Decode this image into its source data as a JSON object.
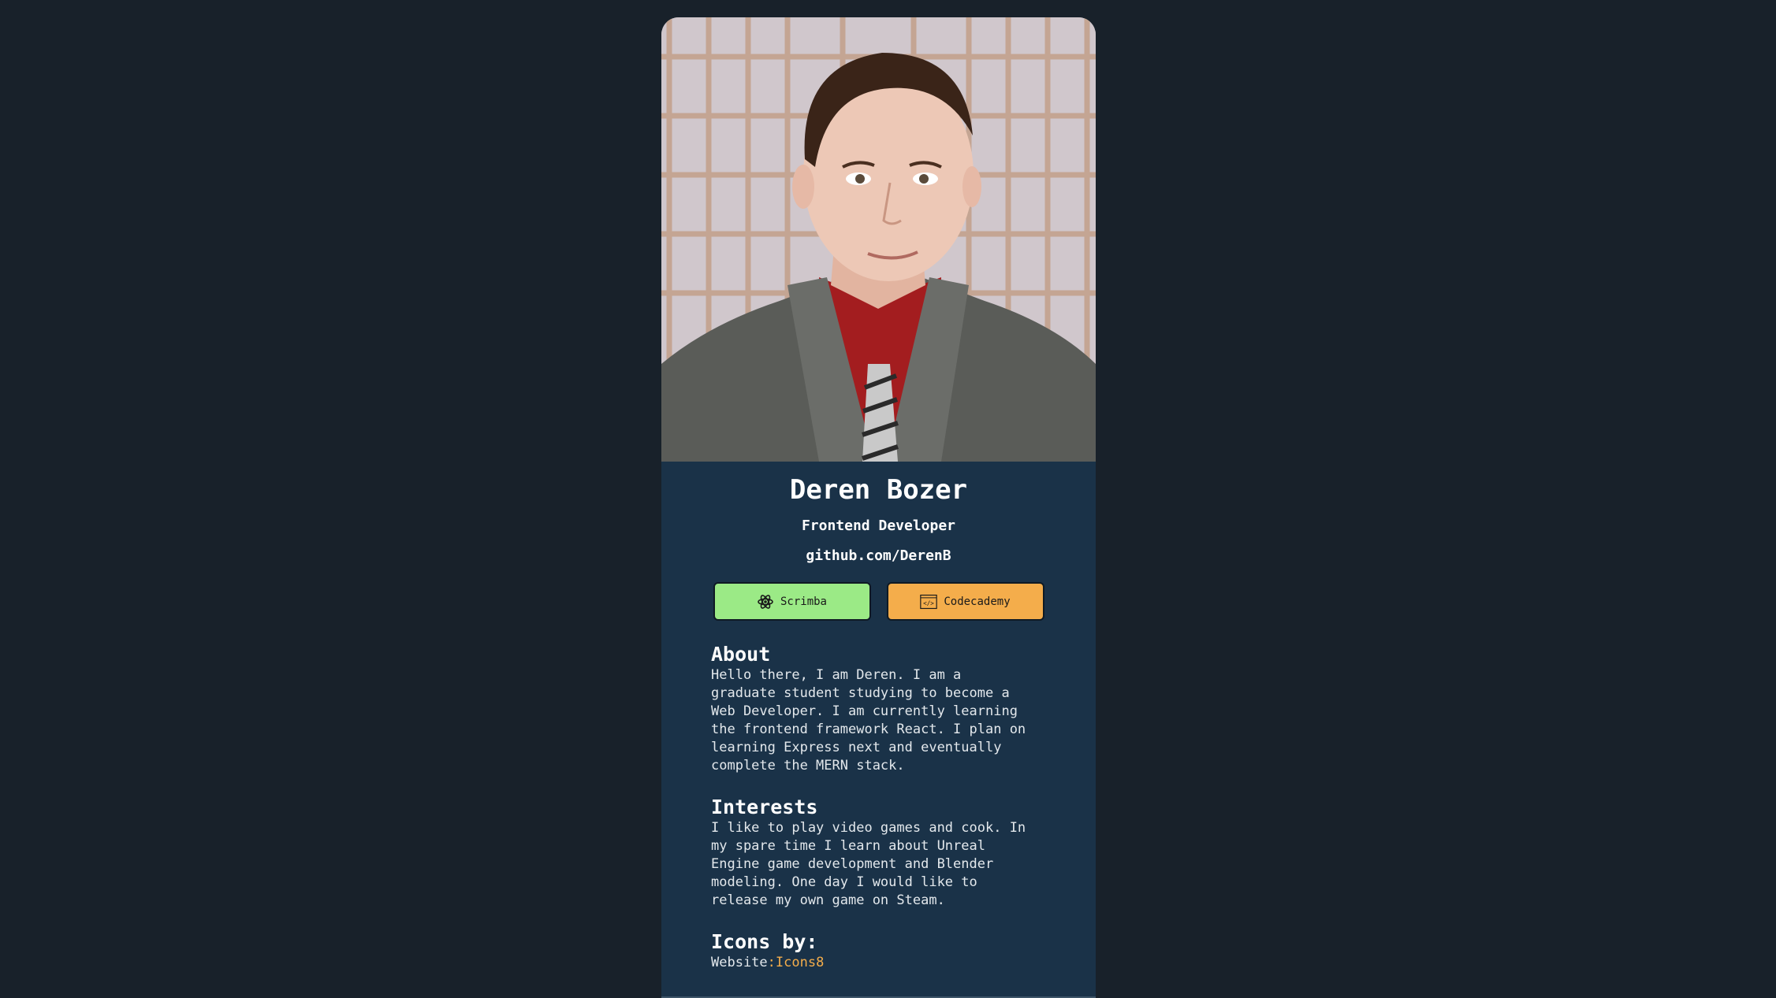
{
  "profile": {
    "photo_alt": "Profile photo",
    "name": "Deren Bozer",
    "title": "Frontend Developer",
    "github": "github.com/DerenB"
  },
  "buttons": {
    "scrimba": {
      "label": "Scrimba",
      "icon": "scrimba-icon",
      "color": "#9bea86"
    },
    "codecademy": {
      "label": "Codecademy",
      "icon": "codecademy-icon",
      "color": "#f4ad4b"
    }
  },
  "about": {
    "heading": "About",
    "text": "Hello there, I am Deren. I am a\ngraduate student studying to become a\nWeb Developer. I am currently learning\nthe frontend framework React. I plan on\nlearning Express next and eventually\ncomplete the MERN stack."
  },
  "interests": {
    "heading": "Interests",
    "text": "I like to play video games and cook. In\nmy spare time I learn about Unreal\nEngine game development and Blender\nmodeling. One day I would like to\nrelease my own game on Steam."
  },
  "icons_by": {
    "heading": "Icons by:",
    "label": "Website",
    "separator": ":",
    "link_text": "Icons8"
  },
  "colors": {
    "page_bg": "#18212a",
    "card_bg": "#1a3248",
    "accent": "#f4ad4b"
  }
}
